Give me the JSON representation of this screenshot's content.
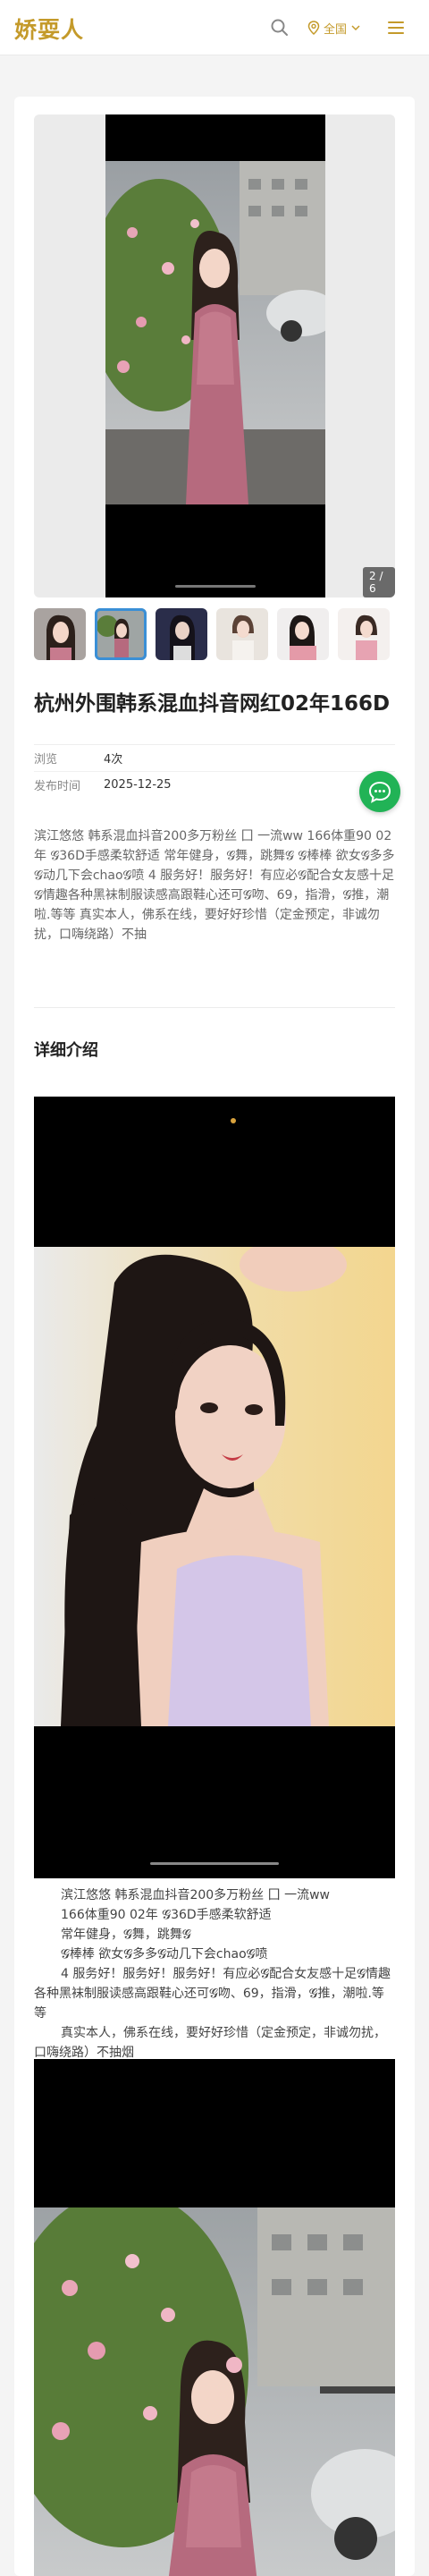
{
  "header": {
    "logo": "娇耍人",
    "region_label": "全国",
    "icons": [
      "search-icon",
      "location-icon",
      "chevron-down-icon",
      "menu-icon"
    ]
  },
  "colors": {
    "brand": "#c49a2a",
    "chat": "#21b356",
    "active_thumb": "#3a8fd6"
  },
  "gallery": {
    "counter": "2 / 6",
    "thumb_count": 6,
    "active_thumb": 2
  },
  "listing": {
    "title": "杭州外围韩系混血抖音网红02年166D",
    "meta": [
      {
        "label": "浏览",
        "value": "4次"
      },
      {
        "label": "发布时间",
        "value": "2025-12-25"
      }
    ],
    "description": "滨江悠悠 韩系混血抖音200多万粉丝 囗 一流ww 166体重90 02年 𝓖36D手感柔软舒适 常年健身，𝓖舞，跳舞𝓖 𝓖棒棒 欲女𝓖多多𝓖动几下会chao𝓖喷 4 服务好！服务好！有应必𝓖配合女友感十足𝓖情趣各种黑袜制服读感高跟鞋心还可𝓖吻、69，指滑，𝓖推，潮啦.等等 真实本人，佛系在线，要好好珍惜（定金预定，非诚勿扰，口嗨绕路）不抽"
  },
  "detail": {
    "heading": "详细介绍",
    "paragraphs": [
      "滨江悠悠 韩系混血抖音200多万粉丝 囗 一流ww",
      "166体重90 02年 𝓖36D手感柔软舒适",
      "常年健身，𝓖舞，跳舞𝓖",
      "𝓖棒棒 欲女𝓖多多𝓖动几下会chao𝓖喷",
      "4 服务好！服务好！服务好！有应必𝓖配合女友感十足𝓖情趣各种黑袜制服读感高跟鞋心还可𝓖吻、69，指滑，𝓖推，潮啦.等等",
      "真实本人，佛系在线，要好好珍惜（定金预定，非诚勿扰，口嗨绕路）不抽烟"
    ]
  }
}
